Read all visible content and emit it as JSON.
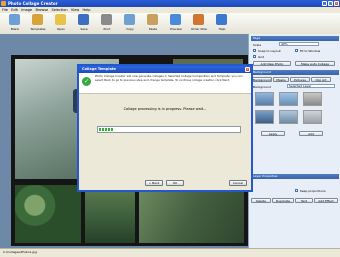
{
  "window": {
    "title": "Photo Collage Creator"
  },
  "menu": [
    "File",
    "Edit",
    "Image",
    "Browse",
    "Selection",
    "View",
    "Help"
  ],
  "toolbar": [
    {
      "label": "Blank",
      "icon": "blank-page-icon",
      "color": "#6ea0d8"
    },
    {
      "label": "Templates",
      "icon": "templates-icon",
      "color": "#d9a33c"
    },
    {
      "label": "Open",
      "icon": "open-folder-icon",
      "color": "#e8c24a"
    },
    {
      "label": "Save",
      "icon": "save-icon",
      "color": "#3d6fc0"
    },
    {
      "label": "Print",
      "icon": "print-icon",
      "color": "#8a8a8a"
    },
    {
      "label": "Copy",
      "icon": "copy-icon",
      "color": "#6fa0d0"
    },
    {
      "label": "Paste",
      "icon": "paste-icon",
      "color": "#c7a060"
    },
    {
      "label": "Preview",
      "icon": "preview-icon",
      "color": "#4a8ad8"
    },
    {
      "label": "Order Now",
      "icon": "order-cart-icon",
      "color": "#d0762e"
    },
    {
      "label": "Help",
      "icon": "help-icon",
      "color": "#3b78d0"
    }
  ],
  "panel": {
    "page_header": "Page",
    "scale_label": "Scale",
    "scale_value": "40%",
    "snap_label": "Snap to Layout",
    "fit_label": "Fit to Window",
    "grid_label": "Grid",
    "add_photo": "Add New Photo",
    "make_collage": "Make Auto Collage",
    "bg_header": "Background",
    "tabs": [
      "Background",
      "Masks",
      "Pictures",
      "Clip Art"
    ],
    "fill_label": "Background",
    "fill_value": "Selected Layer",
    "apply": "Apply",
    "add": "Add",
    "layer_header": "Layer Properties",
    "layer_btns": [
      "Delete",
      "Duplicate",
      "Text",
      "Add Effect"
    ],
    "proportions": "Keep proportions"
  },
  "dialog": {
    "title": "Collage Template",
    "info": "Photo Collage Creator will now generate collages in Selected Collage Composition and Template; you can select Back to go to previous step and change template. To continue collage creation click Next.",
    "message": "Collage processing is in progress. Please wait...",
    "progress": 0.1,
    "back": "< Back",
    "ok": "OK",
    "cancel": "Cancel"
  },
  "status": {
    "text": "C:\\Collages\\Photo1.jpg"
  }
}
